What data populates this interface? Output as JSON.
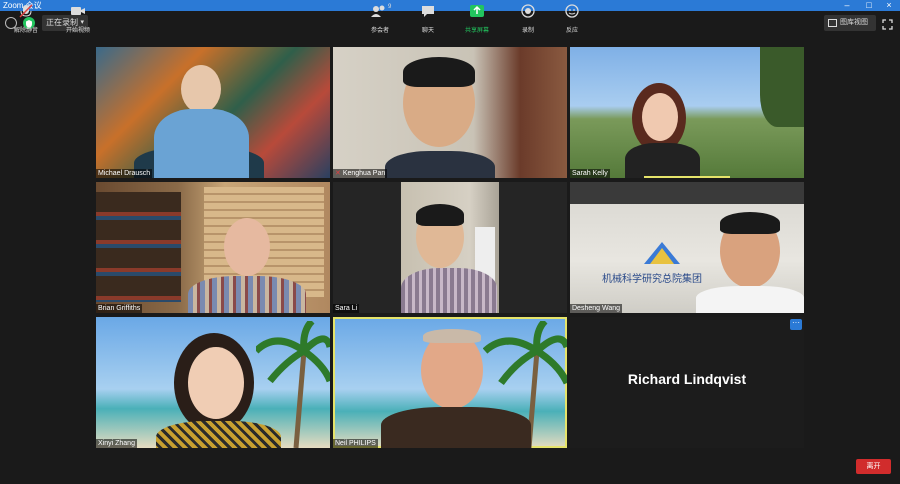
{
  "window": {
    "title": "Zoom 会议"
  },
  "topbar": {
    "recording_label": "正在录制",
    "view_label": "图库视图"
  },
  "tiles": [
    {
      "name": "Michael Drausch"
    },
    {
      "name": "Kenghua Pan"
    },
    {
      "name": "Sarah Kelly"
    },
    {
      "name": "Brian Griffiths"
    },
    {
      "name": "Sara Li"
    },
    {
      "name": "Desheng Wang"
    },
    {
      "name": "Xinyi Zhang"
    },
    {
      "name": "Neil PHILIPS"
    },
    {
      "name": "Richard Lindqvist"
    }
  ],
  "tile5_sign": "机械科学研究总院集团",
  "bottombar": {
    "mute_label": "解除静音",
    "video_label": "开始视频",
    "participants_label": "参会者",
    "participants_count": "9",
    "chat_label": "聊天",
    "share_label": "共享屏幕",
    "record_label": "录制",
    "reactions_label": "反应",
    "end_label": "离开"
  },
  "colors": {
    "titlebar": "#2b7ad6",
    "share_green": "#22c55e",
    "end_red": "#d12c2c",
    "active_border": "#e5e36a"
  }
}
